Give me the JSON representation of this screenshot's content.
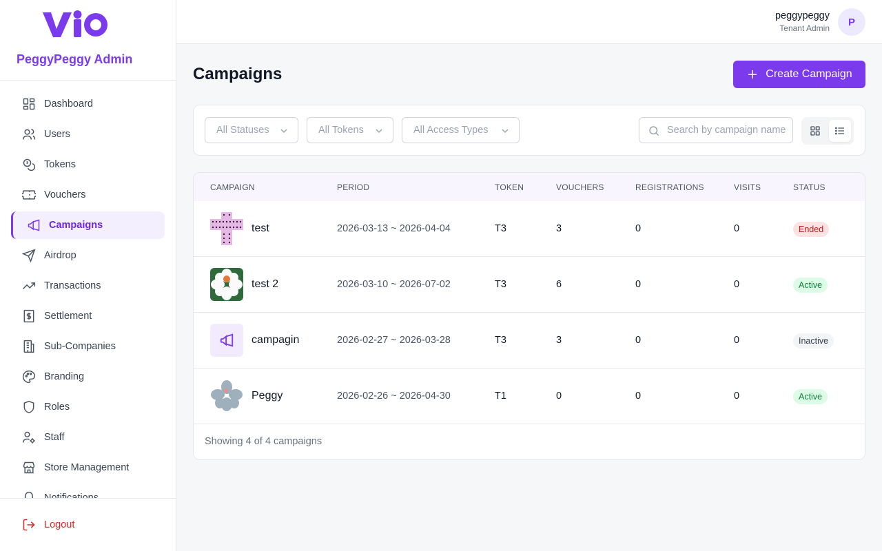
{
  "sidebar": {
    "brand_name": "PeggyPeggy Admin",
    "items": [
      {
        "label": "Dashboard",
        "icon": "dashboard-icon"
      },
      {
        "label": "Users",
        "icon": "users-icon"
      },
      {
        "label": "Tokens",
        "icon": "coins-icon"
      },
      {
        "label": "Vouchers",
        "icon": "ticket-icon"
      },
      {
        "label": "Campaigns",
        "icon": "megaphone-icon",
        "active": true
      },
      {
        "label": "Airdrop",
        "icon": "send-icon"
      },
      {
        "label": "Transactions",
        "icon": "trending-up-icon"
      },
      {
        "label": "Settlement",
        "icon": "receipt-dollar-icon"
      },
      {
        "label": "Sub-Companies",
        "icon": "building-icon"
      },
      {
        "label": "Branding",
        "icon": "palette-icon"
      },
      {
        "label": "Roles",
        "icon": "shield-icon"
      },
      {
        "label": "Staff",
        "icon": "user-cog-icon"
      },
      {
        "label": "Store Management",
        "icon": "store-icon"
      },
      {
        "label": "Notifications",
        "icon": "bell-icon"
      }
    ],
    "logout_label": "Logout"
  },
  "header": {
    "user_name": "peggypeggy",
    "user_role": "Tenant Admin",
    "avatar_initial": "P"
  },
  "main": {
    "title": "Campaigns",
    "create_button": "Create Campaign",
    "filters": {
      "status": "All Statuses",
      "tokens": "All Tokens",
      "access": "All Access Types",
      "search_placeholder": "Search by campaign name"
    },
    "table": {
      "columns": [
        "CAMPAIGN",
        "PERIOD",
        "TOKEN",
        "VOUCHERS",
        "REGISTRATIONS",
        "VISITS",
        "STATUS"
      ],
      "rows": [
        {
          "name": "test",
          "period": "2026-03-13 ~ 2026-04-04",
          "token": "T3",
          "vouchers": "3",
          "registrations": "0",
          "visits": "0",
          "status": "Ended",
          "thumb": "pattern-image"
        },
        {
          "name": "test 2",
          "period": "2026-03-10 ~ 2026-07-02",
          "token": "T3",
          "vouchers": "6",
          "registrations": "0",
          "visits": "0",
          "status": "Active",
          "thumb": "flower-image"
        },
        {
          "name": "campagin",
          "period": "2026-02-27 ~ 2026-03-28",
          "token": "T3",
          "vouchers": "3",
          "registrations": "0",
          "visits": "0",
          "status": "Inactive",
          "thumb": "megaphone-placeholder"
        },
        {
          "name": "Peggy",
          "period": "2026-02-26 ~ 2026-04-30",
          "token": "T1",
          "vouchers": "0",
          "registrations": "0",
          "visits": "0",
          "status": "Active",
          "thumb": "grey-flower-image"
        }
      ],
      "footer": "Showing 4 of 4 campaigns"
    }
  },
  "colors": {
    "accent": "#7c3aed",
    "ended": "#b91c1c",
    "active": "#15803d"
  }
}
